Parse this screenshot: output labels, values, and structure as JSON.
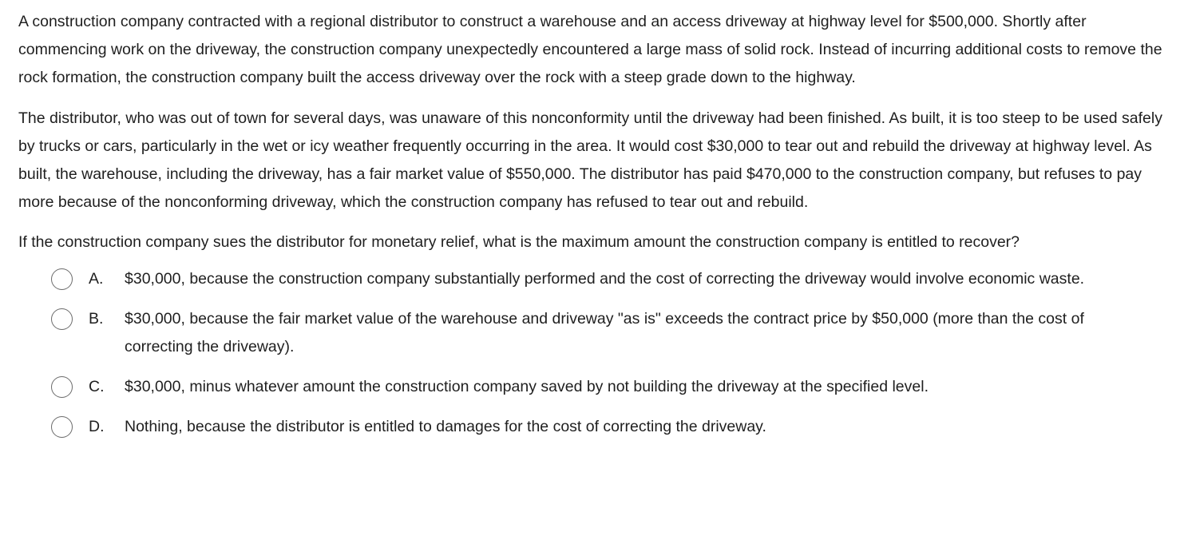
{
  "passage": {
    "paragraph1": "A construction company contracted with a regional distributor to construct a warehouse and an access driveway at highway level for $500,000. Shortly after commencing work on the driveway, the construction company unexpectedly encountered a large mass of solid rock. Instead of incurring additional costs to remove the rock formation, the construction company built the access driveway over the rock with a steep grade down to the highway.",
    "paragraph2": "The distributor, who was out of town for several days, was unaware of this nonconformity until the driveway had been finished. As built, it is too steep to be used safely by trucks or cars, particularly in the wet or icy weather frequently occurring in the area. It would cost $30,000 to tear out and rebuild the driveway at highway level. As built, the warehouse, including the driveway, has a fair market value of $550,000. The distributor has paid $470,000 to the construction company, but refuses to pay more because of the nonconforming driveway, which the construction company has refused to tear out and rebuild."
  },
  "question": "If the construction company sues the distributor for monetary relief, what is the maximum amount the construction company is entitled to recover?",
  "options": [
    {
      "letter": "A.",
      "text": "$30,000, because the construction company substantially performed and the cost of correcting the driveway would involve economic waste."
    },
    {
      "letter": "B.",
      "text": "$30,000, because the fair market value of the warehouse and driveway \"as is\" exceeds the contract price by $50,000 (more than the cost of correcting the driveway)."
    },
    {
      "letter": "C.",
      "text": "$30,000, minus whatever amount the construction company saved by not building the driveway at the specified level."
    },
    {
      "letter": "D.",
      "text": "Nothing, because the distributor is entitled to damages for the cost of correcting the driveway."
    }
  ]
}
